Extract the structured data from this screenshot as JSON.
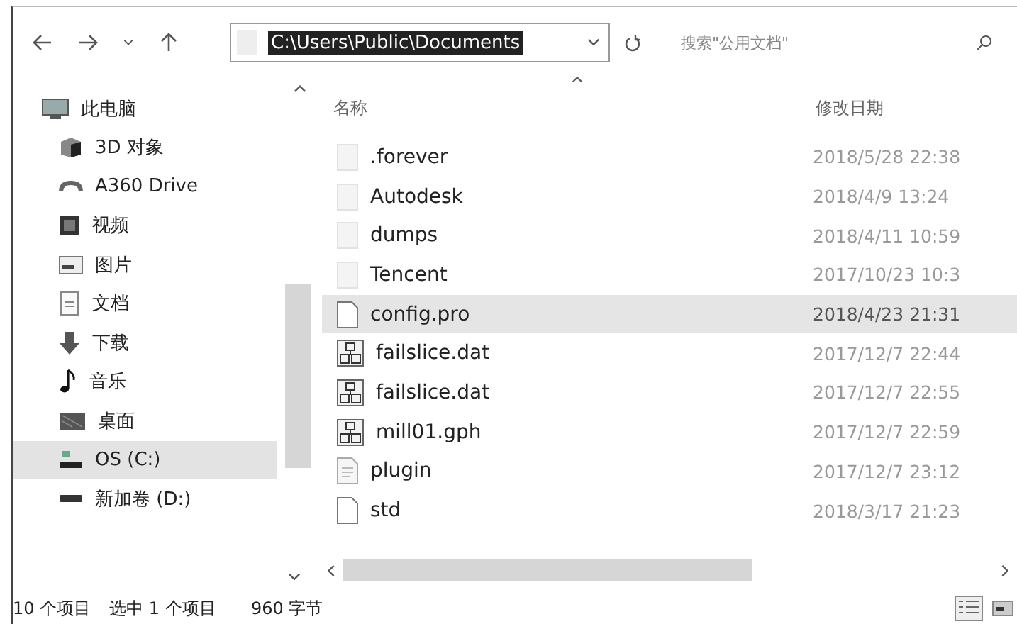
{
  "toolbar": {
    "address": "C:\\Users\\Public\\Documents",
    "address_selected": true,
    "search": {
      "placeholder": "搜索\"公用文档\""
    }
  },
  "sidebar": {
    "items": [
      {
        "label": "此电脑",
        "kind": "pc",
        "selected": false,
        "children": [
          {
            "label": "3D 对象",
            "kind": "cube",
            "selected": false
          },
          {
            "label": "A360 Drive",
            "kind": "cloud",
            "selected": false
          },
          {
            "label": "视频",
            "kind": "video",
            "selected": false
          },
          {
            "label": "图片",
            "kind": "pictures",
            "selected": false
          },
          {
            "label": "文档",
            "kind": "docs",
            "selected": false
          },
          {
            "label": "下载",
            "kind": "download",
            "selected": false
          },
          {
            "label": "音乐",
            "kind": "music",
            "selected": false
          },
          {
            "label": "桌面",
            "kind": "desktop",
            "selected": false
          },
          {
            "label": "OS (C:)",
            "kind": "osdrive",
            "selected": true
          },
          {
            "label": "新加卷 (D:)",
            "kind": "drive",
            "selected": false
          }
        ]
      }
    ]
  },
  "table": {
    "columns": [
      "名称",
      "修改日期"
    ],
    "rows": [
      {
        "name": ".forever",
        "date": "2018/5/28 22:38",
        "kind": "folder",
        "selected": false
      },
      {
        "name": "Autodesk",
        "date": "2018/4/9 13:24",
        "kind": "folder",
        "selected": false
      },
      {
        "name": "dumps",
        "date": "2018/4/11 10:59",
        "kind": "folder",
        "selected": false
      },
      {
        "name": "Tencent",
        "date": "2017/10/23 10:3",
        "kind": "folder",
        "selected": false
      },
      {
        "name": "config.pro",
        "date": "2018/4/23 21:31",
        "kind": "file",
        "selected": true
      },
      {
        "name": "failslice.dat",
        "date": "2017/12/7 22:44",
        "kind": "app",
        "selected": false
      },
      {
        "name": "failslice.dat",
        "date": "2017/12/7 22:55",
        "kind": "app",
        "selected": false
      },
      {
        "name": "mill01.gph",
        "date": "2017/12/7 22:59",
        "kind": "app",
        "selected": false
      },
      {
        "name": "plugin",
        "date": "2017/12/7 23:12",
        "kind": "doc",
        "selected": false
      },
      {
        "name": "std",
        "date": "2018/3/17 21:23",
        "kind": "file",
        "selected": false
      }
    ]
  },
  "status_bar": {
    "count": "10 个项目",
    "selection": "选中 1 个项目",
    "size": "960 字节"
  },
  "view_buttons": [
    {
      "kind": "details",
      "selected": true
    },
    {
      "kind": "tiles",
      "selected": false
    }
  ]
}
